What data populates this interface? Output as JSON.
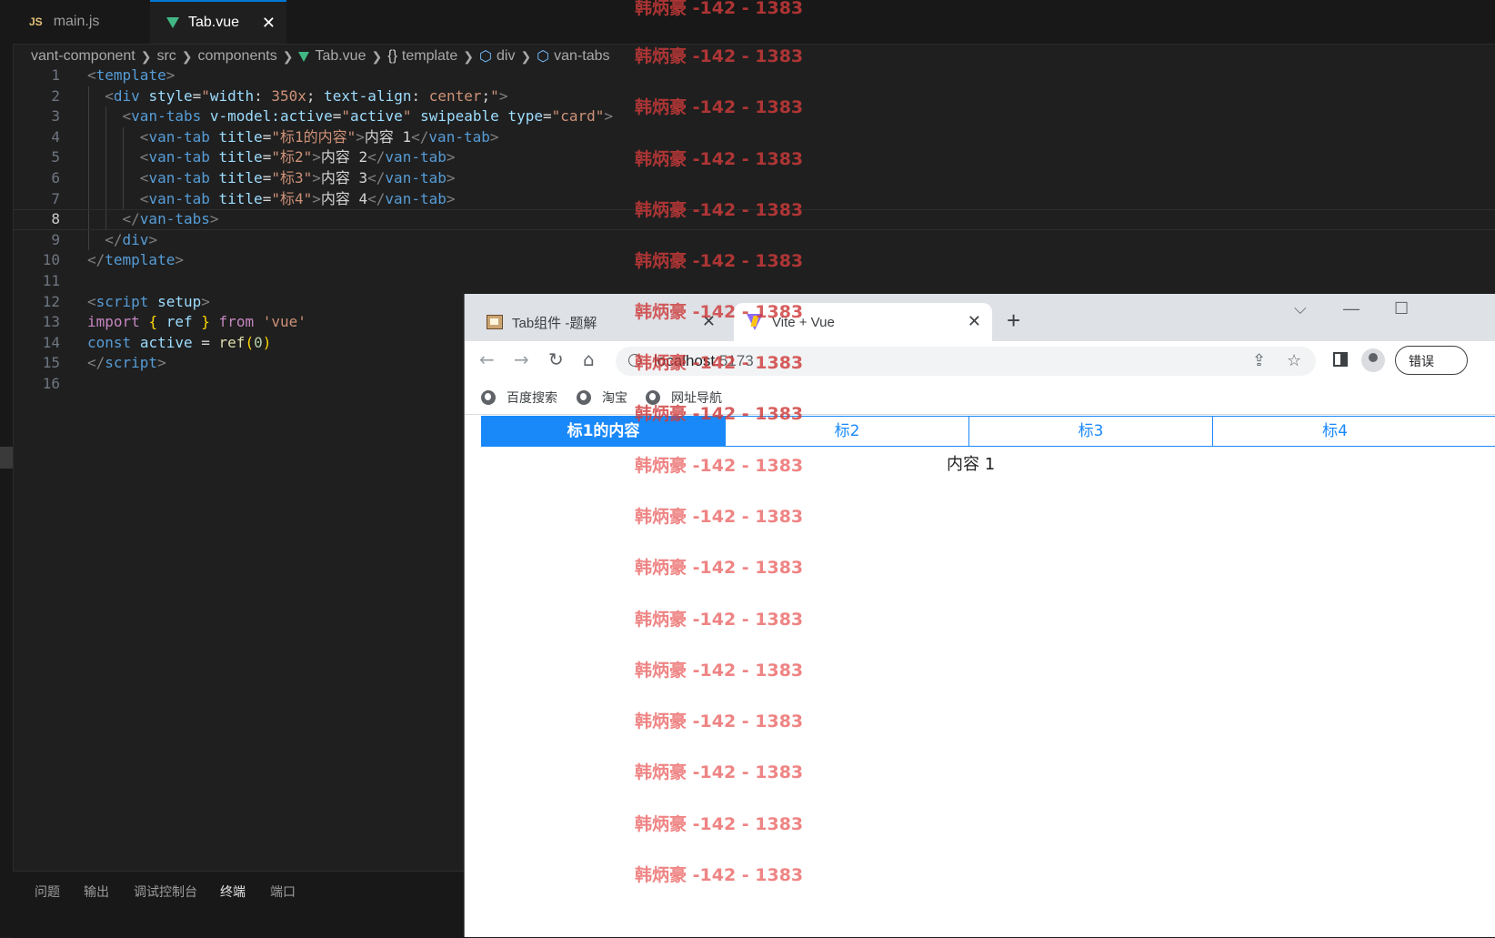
{
  "editor": {
    "tabs": [
      {
        "badge": "JS",
        "label": "main.js"
      },
      {
        "label": "Tab.vue",
        "close": "✕"
      }
    ],
    "breadcrumb": [
      "vant-component",
      "src",
      "components",
      "Tab.vue",
      "template",
      "div",
      "van-tabs"
    ],
    "active_line": 8,
    "panel_tabs": [
      "问题",
      "输出",
      "调试控制台",
      "终端",
      "端口"
    ]
  },
  "browser": {
    "tabs": [
      {
        "title": "Tab组件 -题解"
      },
      {
        "title": "Vite + Vue"
      }
    ],
    "url_host": "localhost",
    "url_port": ":5173",
    "error_pill": "错误",
    "bookmarks": [
      "百度搜索",
      "淘宝",
      "网址导航"
    ],
    "vant_tabs": [
      "标1的内容",
      "标2",
      "标3",
      "标4"
    ],
    "active_tab_index": 0,
    "content": "内容 1"
  },
  "watermark": "韩炳豪 -142 - 1383"
}
